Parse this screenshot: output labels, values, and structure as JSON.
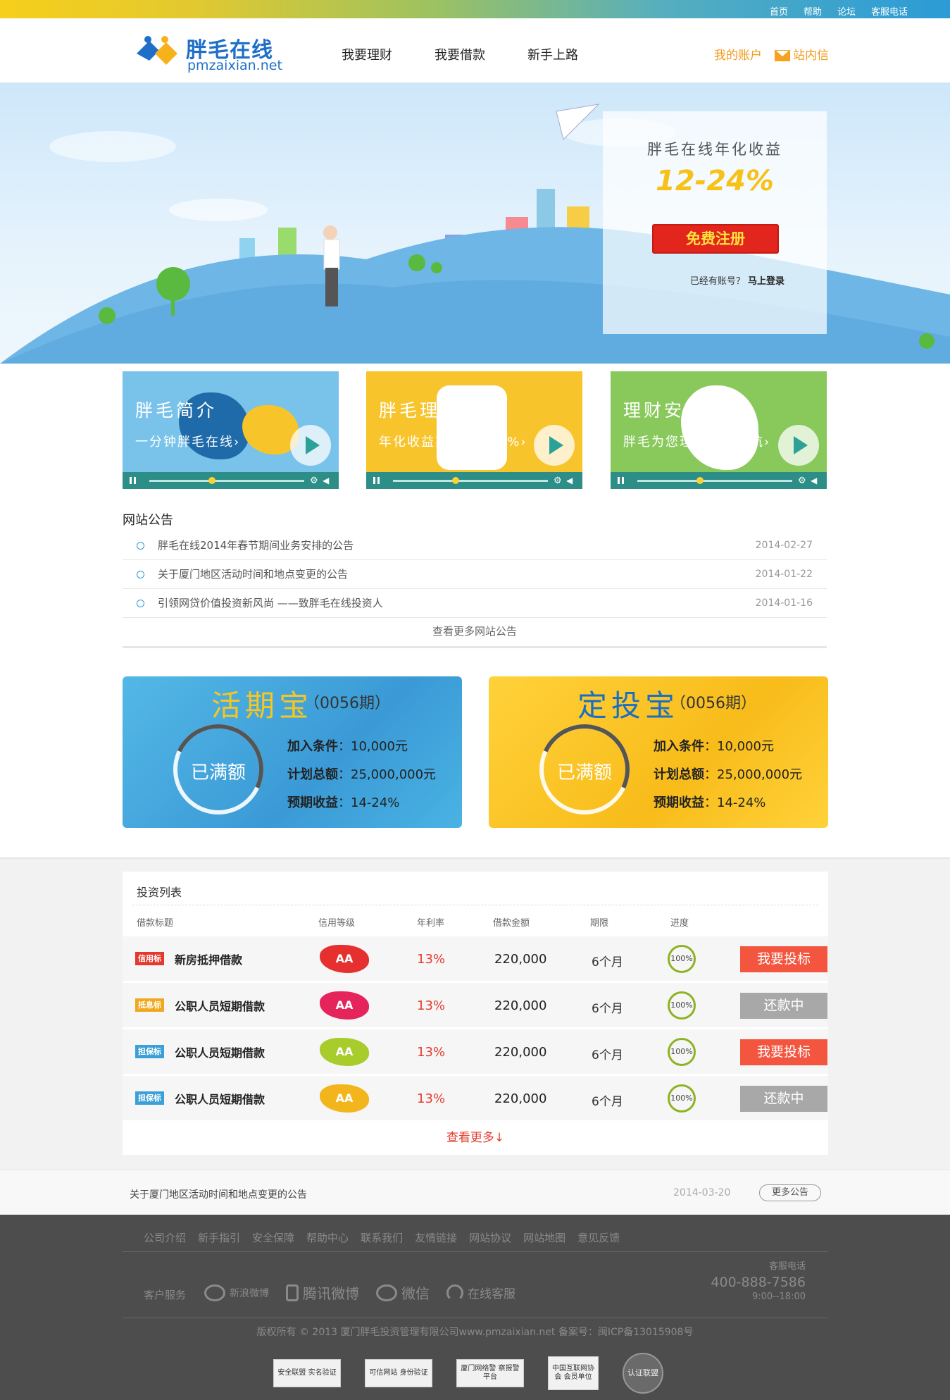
{
  "top": {
    "links": [
      "首页",
      "帮助",
      "论坛",
      "客服电话"
    ]
  },
  "header": {
    "logo_cn": "胖毛在线",
    "logo_en": "pmzaixian.net",
    "nav": [
      "我要理财",
      "我要借款",
      "新手上路"
    ],
    "account": "我的账户",
    "inbox": "站内信"
  },
  "banner": {
    "title": "胖毛在线年化收益",
    "rate": "12-24%",
    "register": "免费注册",
    "login_prompt": "已经有账号？",
    "login_link": "马上登录"
  },
  "videos": [
    {
      "title": "胖毛简介",
      "sub": "一分钟胖毛在线›",
      "bg": "#79c3eb"
    },
    {
      "title": "胖毛理财",
      "sub": "年化收益高达12-24%›",
      "bg": "#f8c42c"
    },
    {
      "title": "理财安全",
      "sub": "胖毛为您理财保驾护航›",
      "bg": "#89c95c"
    }
  ],
  "notices": {
    "title": "网站公告",
    "items": [
      {
        "text": "胖毛在线2014年春节期间业务安排的公告",
        "date": "2014-02-27"
      },
      {
        "text": "关于厦门地区活动时间和地点变更的公告",
        "date": "2014-01-22"
      },
      {
        "text": "引领网贷价值投资新风尚 ——致胖毛在线投资人",
        "date": "2014-01-16"
      }
    ],
    "more": "查看更多网站公告"
  },
  "products": [
    {
      "name": "活期宝",
      "no": "（0056期）",
      "status": "已满额",
      "cond_label": "加入条件",
      "cond": "：10,000元",
      "total_label": "计划总额",
      "total": "：25,000,000元",
      "yield_label": "预期收益",
      "yield": "：14-24%"
    },
    {
      "name": "定投宝",
      "no": "（0056期）",
      "status": "已满额",
      "cond_label": "加入条件",
      "cond": "：10,000元",
      "total_label": "计划总额",
      "total": "：25,000,000元",
      "yield_label": "预期收益",
      "yield": "：14-24%"
    }
  ],
  "invest": {
    "title": "投资列表",
    "columns": [
      "借款标题",
      "信用等级",
      "年利率",
      "借款金额",
      "期限",
      "进度"
    ],
    "rows": [
      {
        "tag": "信用标",
        "tag_color": "#e23a2e",
        "name": "新房抵押借款",
        "grade": "AA",
        "grade_color": "#e63030",
        "rate": "13%",
        "amount": "220,000",
        "term": "6个月",
        "progress": "100%",
        "action": "我要投标",
        "action_color": "#f3553f"
      },
      {
        "tag": "抵息标",
        "tag_color": "#f0a81d",
        "name": "公职人员短期借款",
        "grade": "AA",
        "grade_color": "#e6245c",
        "rate": "13%",
        "amount": "220,000",
        "term": "6个月",
        "progress": "100%",
        "action": "还款中",
        "action_color": "#a8a8a8"
      },
      {
        "tag": "担保标",
        "tag_color": "#3b9fd8",
        "name": "公职人员短期借款",
        "grade": "AA",
        "grade_color": "#a7cc2c",
        "rate": "13%",
        "amount": "220,000",
        "term": "6个月",
        "progress": "100%",
        "action": "我要投标",
        "action_color": "#f3553f"
      },
      {
        "tag": "担保标",
        "tag_color": "#3b9fd8",
        "name": "公职人员短期借款",
        "grade": "AA",
        "grade_color": "#f3b51c",
        "rate": "13%",
        "amount": "220,000",
        "term": "6个月",
        "progress": "100%",
        "action": "还款中",
        "action_color": "#a8a8a8"
      }
    ],
    "more": "查看更多↓"
  },
  "ticker": {
    "text": "关于厦门地区活动时间和地点变更的公告",
    "date": "2014-03-20",
    "more": "更多公告"
  },
  "footer": {
    "links": [
      "公司介绍",
      "新手指引",
      "安全保障",
      "帮助中心",
      "联系我们",
      "友情链接",
      "网站协议",
      "网站地图",
      "意见反馈"
    ],
    "cs_label": "客户服务",
    "social": [
      "新浪微博",
      "腾讯微博",
      "微信",
      "在线客服"
    ],
    "hotline_label": "客服电话",
    "hotline": "400-888-7586",
    "hours": "9:00--18:00",
    "copyright": "版权所有 © 2013 厦门胖毛投资管理有限公司www.pmzaixian.net 备案号：闽ICP备13015908号",
    "badges": [
      "安全联盟 实名验证",
      "可信网站 身份验证",
      "厦门网络警 察报警平台",
      "中国互联网协会 会员单位",
      "认证联盟"
    ]
  }
}
